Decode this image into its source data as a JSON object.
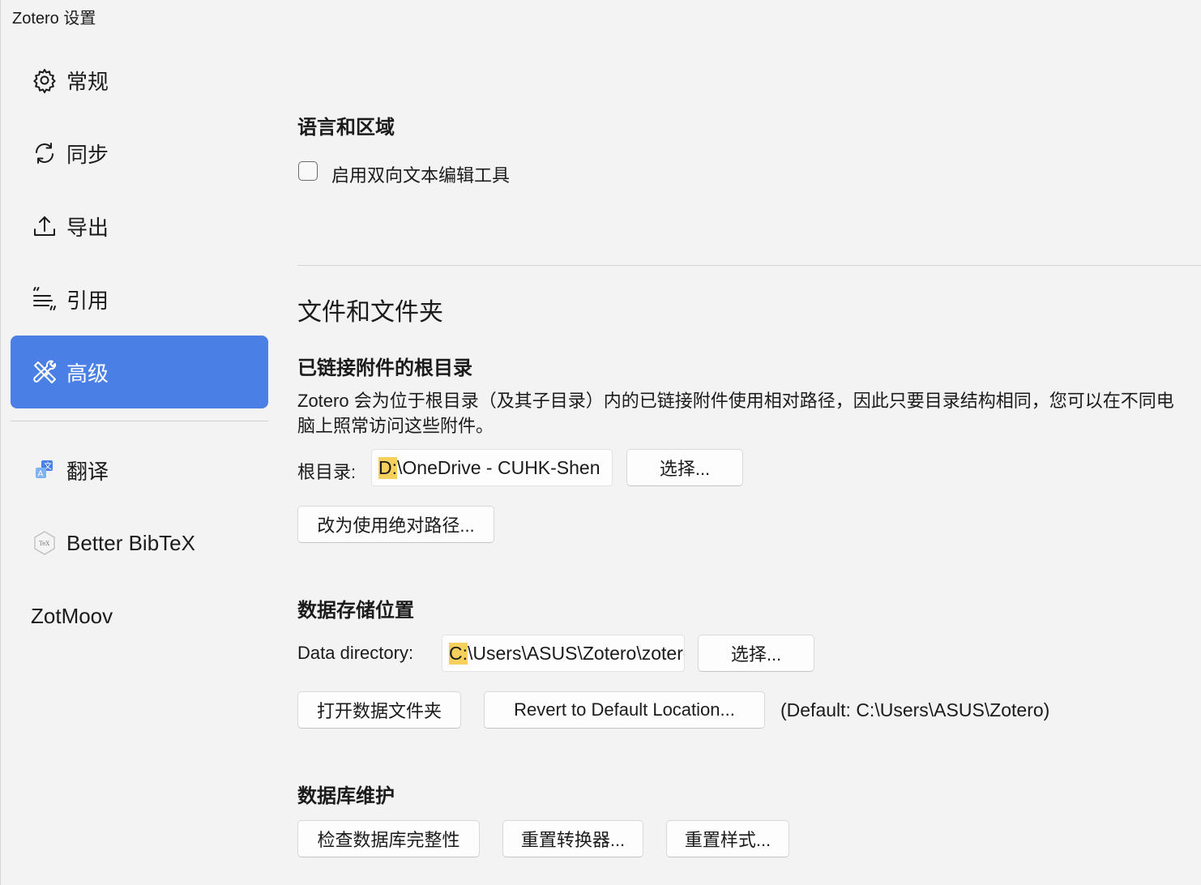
{
  "window": {
    "title": "Zotero 设置"
  },
  "sidebar": {
    "items": [
      {
        "label": "常规",
        "icon": "gear-icon"
      },
      {
        "label": "同步",
        "icon": "sync-icon"
      },
      {
        "label": "导出",
        "icon": "export-icon"
      },
      {
        "label": "引用",
        "icon": "quote-icon"
      },
      {
        "label": "高级",
        "icon": "tools-icon",
        "active": true
      }
    ],
    "plugins": [
      {
        "label": "翻译",
        "icon": "translate-icon"
      },
      {
        "label": "Better BibTeX",
        "icon": "bibtex-icon"
      },
      {
        "label": "ZotMoov"
      }
    ]
  },
  "language": {
    "heading": "语言和区域",
    "bidi_checkbox_label": "启用双向文本编辑工具",
    "bidi_checked": false
  },
  "files": {
    "heading": "文件和文件夹",
    "linked_root": {
      "heading": "已链接附件的根目录",
      "description": "Zotero 会为位于根目录（及其子目录）内的已链接附件使用相对路径，因此只要目录结构相同，您可以在不同电脑上照常访问这些附件。",
      "root_label": "根目录:",
      "root_drive": "D:",
      "root_rest": "\\OneDrive - CUHK-Shen",
      "choose_button": "选择...",
      "absolute_button": "改为使用绝对路径..."
    },
    "data_storage": {
      "heading": "数据存储位置",
      "dir_label": "Data directory:",
      "dir_drive": "C:",
      "dir_rest": "\\Users\\ASUS\\Zotero\\zotero",
      "choose_button": "选择...",
      "open_button": "打开数据文件夹",
      "revert_button": "Revert to Default Location...",
      "default_text": "(Default: C:\\Users\\ASUS\\Zotero)"
    },
    "db_maintenance": {
      "heading": "数据库维护",
      "check_button": "检查数据库完整性",
      "reset_translators_button": "重置转换器...",
      "reset_styles_button": "重置样式..."
    }
  },
  "colors": {
    "accent": "#4a80e6",
    "highlight": "#f5d05c",
    "background": "#f3f3f3"
  }
}
